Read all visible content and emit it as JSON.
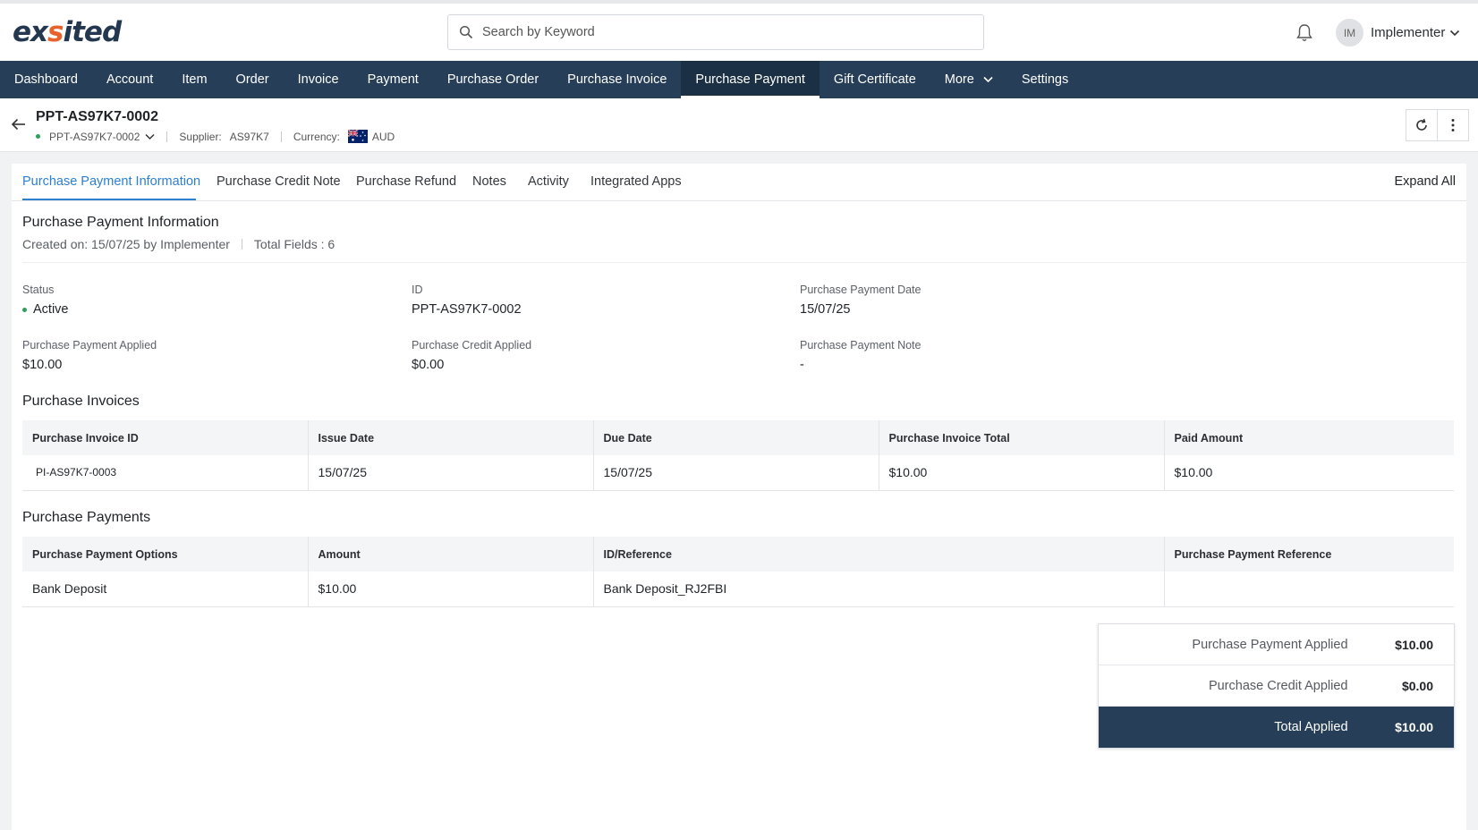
{
  "header": {
    "logo_pre": "ex",
    "logo_accent": "s",
    "logo_post": "ited",
    "search_placeholder": "Search by Keyword",
    "avatar_initials": "IM",
    "user_name": "Implementer"
  },
  "nav": {
    "items": [
      "Dashboard",
      "Account",
      "Item",
      "Order",
      "Invoice",
      "Payment",
      "Purchase Order",
      "Purchase Invoice",
      "Purchase Payment",
      "Gift Certificate",
      "More",
      "Settings"
    ],
    "active": "Purchase Payment"
  },
  "record": {
    "title": "PPT-AS97K7-0002",
    "selector_value": "PPT-AS97K7-0002",
    "supplier_label": "Supplier:",
    "supplier_value": "AS97K7",
    "currency_label": "Currency:",
    "currency_value": "AUD"
  },
  "tabs": {
    "items": [
      "Purchase Payment Information",
      "Purchase Credit Note",
      "Purchase Refund",
      "Notes",
      "Activity",
      "Integrated Apps"
    ],
    "active": "Purchase Payment Information",
    "expand_all": "Expand All"
  },
  "info": {
    "title": "Purchase Payment Information",
    "created": "Created on: 15/07/25 by Implementer",
    "total_fields": "Total Fields : 6",
    "fields": {
      "status_label": "Status",
      "status_value": "Active",
      "id_label": "ID",
      "id_value": "PPT-AS97K7-0002",
      "date_label": "Purchase Payment Date",
      "date_value": "15/07/25",
      "applied_label": "Purchase Payment Applied",
      "applied_value": "$10.00",
      "credit_label": "Purchase Credit Applied",
      "credit_value": "$0.00",
      "note_label": "Purchase Payment Note",
      "note_value": "-"
    }
  },
  "invoices": {
    "title": "Purchase Invoices",
    "columns": [
      "Purchase Invoice ID",
      "Issue Date",
      "Due Date",
      "Purchase Invoice Total",
      "Paid Amount"
    ],
    "rows": [
      [
        "PI-AS97K7-0003",
        "15/07/25",
        "15/07/25",
        "$10.00",
        "$10.00"
      ]
    ]
  },
  "payments": {
    "title": "Purchase Payments",
    "columns": [
      "Purchase Payment Options",
      "Amount",
      "ID/Reference",
      "Purchase Payment Reference"
    ],
    "rows": [
      [
        "Bank Deposit",
        "$10.00",
        "Bank Deposit_RJ2FBI",
        ""
      ]
    ]
  },
  "summary": {
    "rows": [
      {
        "label": "Purchase Payment Applied",
        "value": "$10.00"
      },
      {
        "label": "Purchase Credit Applied",
        "value": "$0.00"
      }
    ],
    "total_label": "Total Applied",
    "total_value": "$10.00"
  },
  "colors": {
    "nav_bg": "#263e57",
    "accent_blue": "#2d7fd0",
    "status_green": "#2e9e5b",
    "logo_orange": "#e8632c"
  }
}
